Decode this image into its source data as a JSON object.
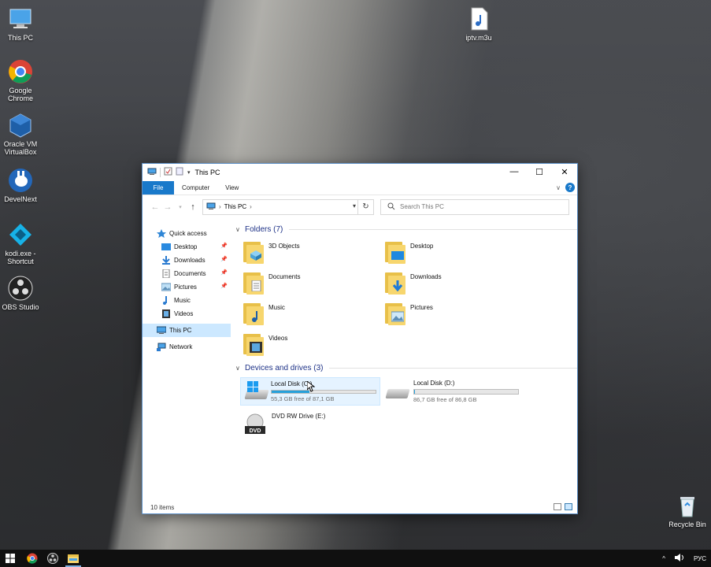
{
  "desktop": {
    "icons": [
      {
        "label": "This PC",
        "icon": "this-pc-icon"
      },
      {
        "label": "Google Chrome",
        "icon": "chrome-icon"
      },
      {
        "label": "Oracle VM VirtualBox",
        "icon": "virtualbox-icon"
      },
      {
        "label": "DevelNext",
        "icon": "develnext-icon"
      },
      {
        "label": "kodi.exe - Shortcut",
        "icon": "kodi-icon"
      },
      {
        "label": "OBS Studio",
        "icon": "obs-icon"
      },
      {
        "label": "iptv.m3u",
        "icon": "playlist-file-icon"
      },
      {
        "label": "Recycle Bin",
        "icon": "recycle-bin-icon"
      }
    ]
  },
  "window": {
    "title": "This PC",
    "controls": {
      "minimize": "—",
      "maximize": "☐",
      "close": "✕"
    },
    "ribbon": {
      "file": "File",
      "computer": "Computer",
      "view": "View"
    },
    "address": {
      "location": "This PC",
      "separator": "›"
    },
    "search": {
      "placeholder": "Search This PC"
    },
    "nav": {
      "quick_access": "Quick access",
      "pinned": [
        {
          "label": "Desktop",
          "pinned": true
        },
        {
          "label": "Downloads",
          "pinned": true
        },
        {
          "label": "Documents",
          "pinned": true
        },
        {
          "label": "Pictures",
          "pinned": true
        },
        {
          "label": "Music",
          "pinned": false
        },
        {
          "label": "Videos",
          "pinned": false
        }
      ],
      "this_pc": "This PC",
      "network": "Network"
    },
    "folders": {
      "header": "Folders (7)",
      "items": [
        "3D Objects",
        "Desktop",
        "Documents",
        "Downloads",
        "Music",
        "Pictures",
        "Videos"
      ]
    },
    "drives": {
      "header": "Devices and drives (3)",
      "items": [
        {
          "name": "Local Disk (C:)",
          "free": "55,3 GB free of 87,1 GB",
          "used_fraction": 0.365
        },
        {
          "name": "Local Disk (D:)",
          "free": "86,7 GB free of 86,8 GB",
          "used_fraction": 0.001
        },
        {
          "name": "DVD RW Drive (E:)"
        }
      ]
    },
    "status": {
      "items": "10 items"
    }
  },
  "taskbar": {
    "language": "РУС",
    "tray_chevron": "^"
  },
  "colors": {
    "accent": "#1979ca",
    "drive_bar": "#26a0da",
    "selection": "#cce8ff",
    "folder": "#f7d66e"
  }
}
